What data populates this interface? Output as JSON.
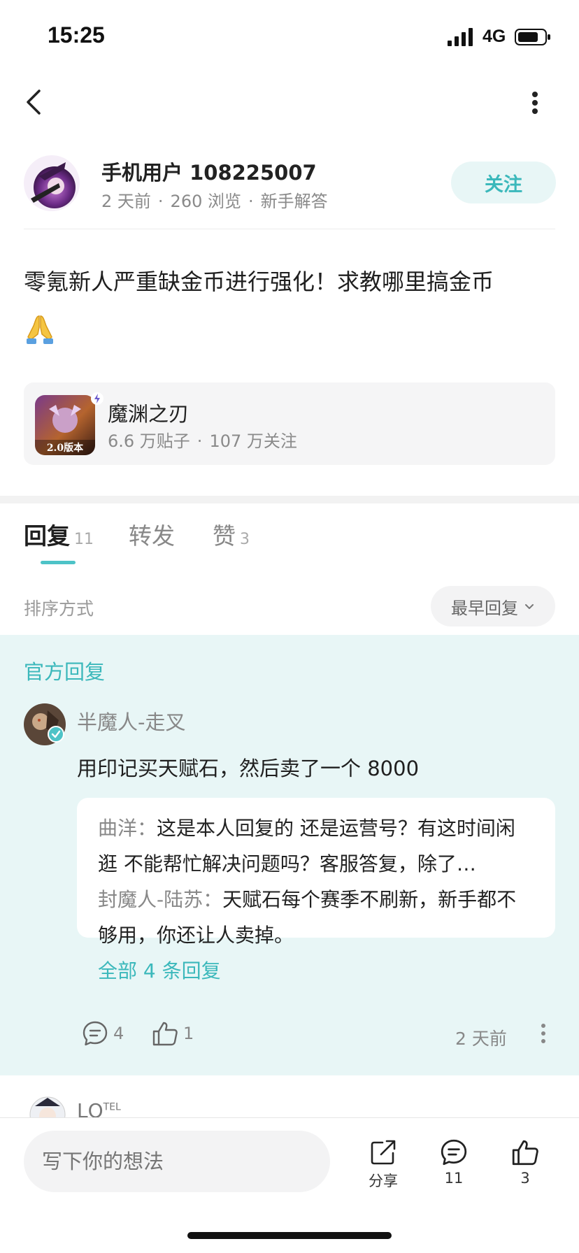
{
  "status_bar": {
    "time": "15:25",
    "network": "4G"
  },
  "nav": {
    "back_icon": "chevron-left-icon",
    "more_icon": "more-vertical-icon"
  },
  "author": {
    "name": "手机用户 108225007",
    "time": "2 天前",
    "views": "260 浏览",
    "category": "新手解答",
    "follow_label": "关注"
  },
  "post": {
    "text": "零氪新人严重缺金币进行强化！求教哪里搞金币",
    "emoji": "🙏"
  },
  "game": {
    "name": "魔渊之刃",
    "posts": "6.6 万贴子",
    "followers": "107 万关注",
    "icon_badge": "2.0版本"
  },
  "tabs": [
    {
      "label": "回复",
      "count": "11"
    },
    {
      "label": "转发",
      "count": ""
    },
    {
      "label": "赞",
      "count": "3"
    }
  ],
  "sort": {
    "label": "排序方式",
    "selected": "最早回复"
  },
  "official_reply": {
    "section_title": "官方回复",
    "author": "半魔人-走叉",
    "text": "用印记买天赋石，然后卖了一个 8000",
    "sub_replies": [
      {
        "author": "曲洋",
        "sep": "：",
        "text": "这是本人回复的 还是运营号？有这时间闲逛 不能帮忙解决问题吗？客服答复，除了…"
      },
      {
        "author": "封魔人-陆苏",
        "sep": "：",
        "text": "天赋石每个赛季不刷新，新手都不够用，你还让人卖掉。"
      }
    ],
    "all_replies_label": "全部 4 条回复",
    "comment_count": "4",
    "like_count": "1",
    "time": "2 天前"
  },
  "next_reply": {
    "name": "LQ",
    "badge": "TEL"
  },
  "bottom_bar": {
    "input_placeholder": "写下你的想法",
    "share_label": "分享",
    "comment_count": "11",
    "like_count": "3"
  },
  "colors": {
    "accent": "#3bb8bb",
    "official_bg": "#e8f6f6"
  }
}
